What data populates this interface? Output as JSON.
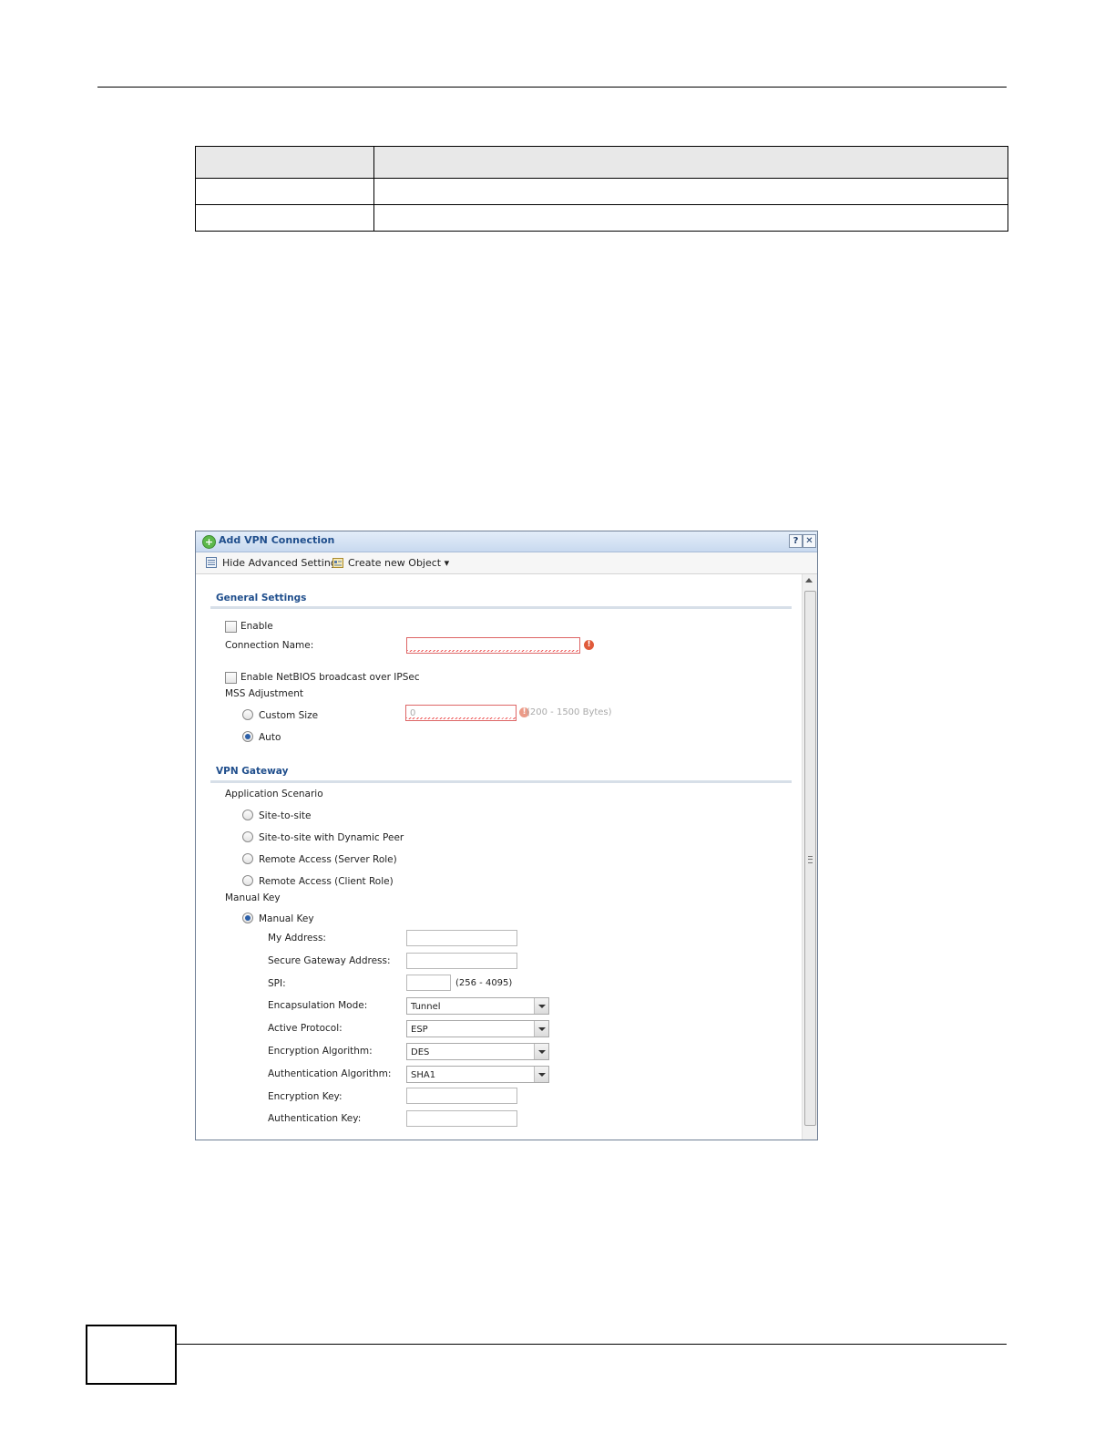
{
  "dialog": {
    "title": "Add VPN Connection",
    "help_symbol": "?",
    "close_symbol": "✕",
    "toolbar": {
      "hide_advanced_label": "Hide Advanced Settings",
      "create_object_label": "Create new Object ▾"
    },
    "general": {
      "heading": "General Settings",
      "enable_label": "Enable",
      "enable_checked": false,
      "connection_name_label": "Connection Name:",
      "connection_name_value": "",
      "netbios_label": "Enable NetBIOS broadcast over IPSec",
      "netbios_checked": false,
      "mss_label": "MSS Adjustment",
      "custom_size_label": "Custom Size",
      "custom_size_value": "0",
      "custom_size_hint": "(200 - 1500 Bytes)",
      "auto_label": "Auto",
      "auto_selected": true
    },
    "gateway": {
      "heading": "VPN Gateway",
      "scenario_label": "Application Scenario",
      "scenarios": [
        "Site-to-site",
        "Site-to-site with Dynamic Peer",
        "Remote Access (Server Role)",
        "Remote Access (Client Role)"
      ],
      "manual_key_group_label": "Manual Key",
      "manual_key_label": "Manual Key",
      "manual_key_selected": true,
      "my_address_label": "My Address:",
      "secure_gateway_label": "Secure Gateway Address:",
      "spi_label": "SPI:",
      "spi_hint": "(256 - 4095)",
      "encapsulation_label": "Encapsulation Mode:",
      "encapsulation_value": "Tunnel",
      "active_protocol_label": "Active Protocol:",
      "active_protocol_value": "ESP",
      "encryption_algorithm_label": "Encryption Algorithm:",
      "encryption_algorithm_value": "DES",
      "authentication_algorithm_label": "Authentication Algorithm:",
      "authentication_algorithm_value": "SHA1",
      "encryption_key_label": "Encryption Key:",
      "authentication_key_label": "Authentication Key:"
    },
    "error_icon": "!",
    "colors": {
      "title_text": "#1f4e8c",
      "error": "#e05a3a",
      "radio_dot": "#2b5fa8"
    }
  }
}
